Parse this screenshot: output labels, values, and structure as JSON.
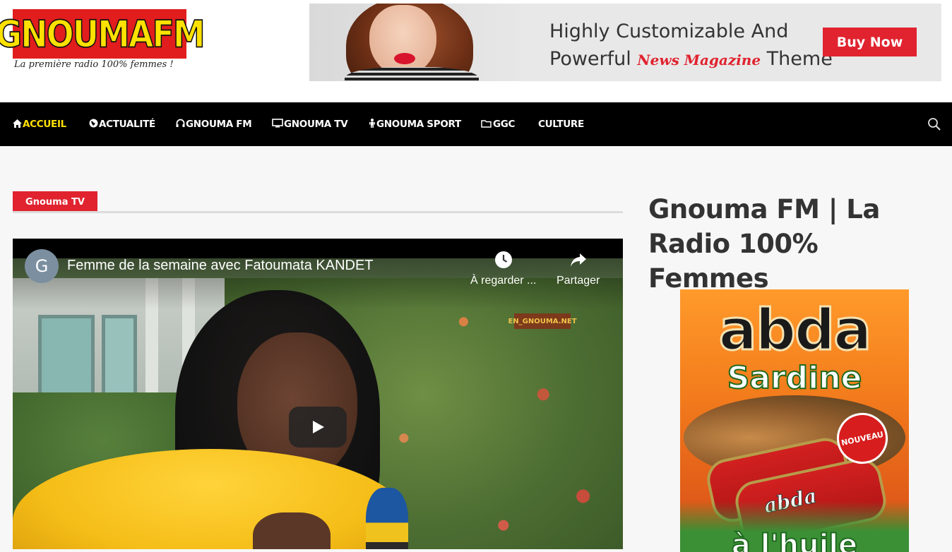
{
  "header": {
    "logo_text": "GNOUMAFM",
    "logo_tagline": "La première radio 100% femmes !",
    "banner": {
      "line1": "Highly Customizable And",
      "line2_prefix": "Powerful",
      "line2_accent": "News Magazine",
      "line2_suffix": "Theme",
      "button_label": "Buy Now",
      "accent_color": "#e0232f"
    }
  },
  "nav": {
    "items": [
      {
        "label": "ACCUEIL",
        "icon": "home-icon",
        "active": true
      },
      {
        "label": "ACTUALITÉ",
        "icon": "globe-icon",
        "active": false
      },
      {
        "label": "GNOUMA FM",
        "icon": "headphones-icon",
        "active": false
      },
      {
        "label": "GNOUMA TV",
        "icon": "monitor-icon",
        "active": false
      },
      {
        "label": "GNOUMA SPORT",
        "icon": "runner-icon",
        "active": false
      },
      {
        "label": "GGC",
        "icon": "folder-icon",
        "active": false
      },
      {
        "label": "CULTURE",
        "icon": "",
        "active": false
      }
    ],
    "search_icon": "search-icon",
    "active_color": "#ffe100"
  },
  "main": {
    "category_tag": "Gnouma TV",
    "video": {
      "channel_initial": "G",
      "title": "Femme de la semaine avec Fatoumata KANDET",
      "watch_later_label": "À regarder ...",
      "share_label": "Partager",
      "watermark": "EN_GNOUMA.NET"
    }
  },
  "sidebar": {
    "title": "Gnouma FM | La Radio 100% Femmes",
    "ad": {
      "brand": "abda",
      "product": "Sardine",
      "can_label": "abda",
      "seal": "NOUVEAU",
      "bottom_text": "à l'huile"
    }
  }
}
